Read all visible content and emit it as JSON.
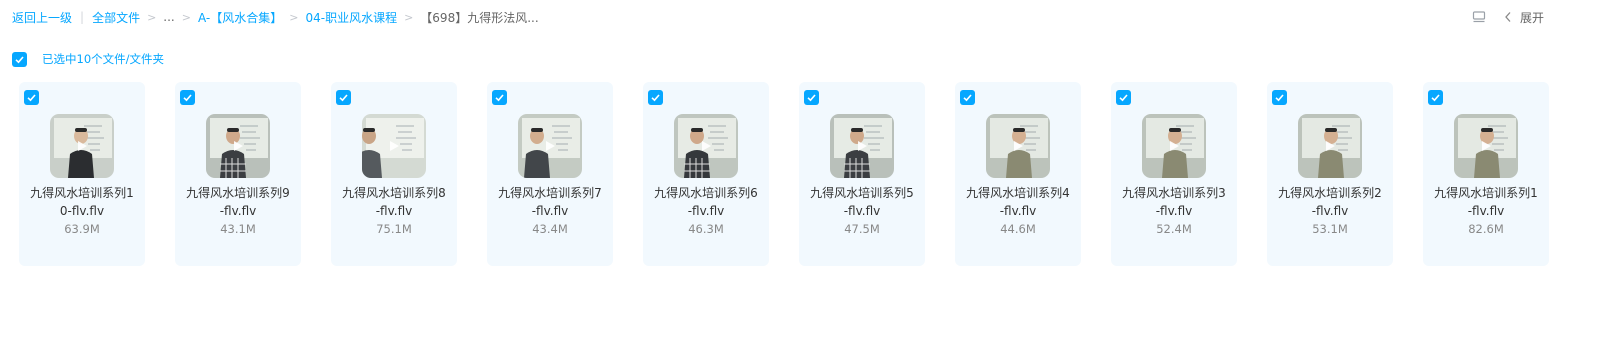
{
  "breadcrumb": {
    "back": "返回上一级",
    "items": [
      "全部文件",
      "...",
      "A-【风水合集】",
      "04-职业风水课程"
    ],
    "current": "【698】九得形法风...",
    "separator": ">",
    "pipe": "|"
  },
  "top_right": {
    "view_icon": "list-view-icon",
    "expand_icon": "chevron-left-icon",
    "expand_label": "展开"
  },
  "selection": {
    "checked": true,
    "label": "已选中10个文件/文件夹"
  },
  "colors": {
    "accent": "#06a7ff",
    "card_bg": "#f2f9fe"
  },
  "files": [
    {
      "name_line1": "九得风水培训系列1",
      "name_line2": "0-flv.flv",
      "size": "63.9M",
      "checked": true,
      "thumb": "teacher-dark-jacket"
    },
    {
      "name_line1": "九得风水培训系列9",
      "name_line2": "-flv.flv",
      "size": "43.1M",
      "checked": true,
      "thumb": "teacher-plaid-shirt"
    },
    {
      "name_line1": "九得风水培训系列8",
      "name_line2": "-flv.flv",
      "size": "75.1M",
      "checked": true,
      "thumb": "whiteboard-close"
    },
    {
      "name_line1": "九得风水培训系列7",
      "name_line2": "-flv.flv",
      "size": "43.4M",
      "checked": true,
      "thumb": "teacher-whiteboard"
    },
    {
      "name_line1": "九得风水培训系列6",
      "name_line2": "-flv.flv",
      "size": "46.3M",
      "checked": true,
      "thumb": "teacher-plaid-board"
    },
    {
      "name_line1": "九得风水培训系列5",
      "name_line2": "-flv.flv",
      "size": "47.5M",
      "checked": true,
      "thumb": "teacher-plaid-shirt"
    },
    {
      "name_line1": "九得风水培训系列4",
      "name_line2": "-flv.flv",
      "size": "44.6M",
      "checked": true,
      "thumb": "teacher-khaki"
    },
    {
      "name_line1": "九得风水培训系列3",
      "name_line2": "-flv.flv",
      "size": "52.4M",
      "checked": true,
      "thumb": "teacher-khaki"
    },
    {
      "name_line1": "九得风水培训系列2",
      "name_line2": "-flv.flv",
      "size": "53.1M",
      "checked": true,
      "thumb": "teacher-khaki"
    },
    {
      "name_line1": "九得风水培训系列1",
      "name_line2": "-flv.flv",
      "size": "82.6M",
      "checked": true,
      "thumb": "teacher-khaki"
    }
  ]
}
